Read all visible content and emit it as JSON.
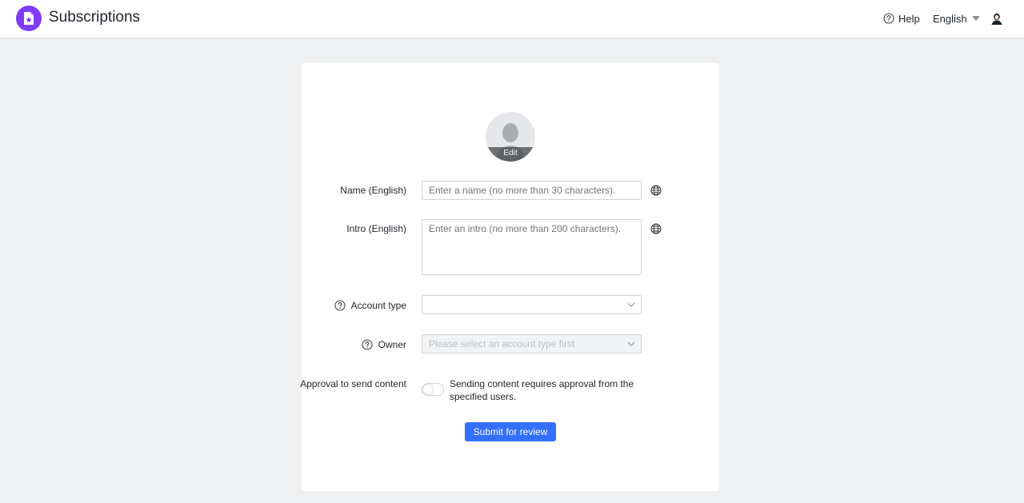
{
  "header": {
    "app_title": "Subscriptions",
    "logo_icon": "document-star-icon",
    "brand_color": "#7f3bf5",
    "help_label": "Help",
    "language_label": "English"
  },
  "form": {
    "avatar_edit_label": "Edit",
    "name": {
      "label": "Name (English)",
      "placeholder": "Enter a name (no more than 30 characters).",
      "value": ""
    },
    "intro": {
      "label": "Intro (English)",
      "placeholder": "Enter an intro (no more than 200 characters).",
      "value": ""
    },
    "account_type": {
      "label": "Account type",
      "value": ""
    },
    "owner": {
      "label": "Owner",
      "placeholder": "Please select an account type first",
      "disabled": true
    },
    "approval": {
      "label": "Approval to send content",
      "description": "Sending content requires approval from the specified users.",
      "enabled": false
    },
    "submit_label": "Submit for review",
    "accent_color": "#3370ff"
  }
}
